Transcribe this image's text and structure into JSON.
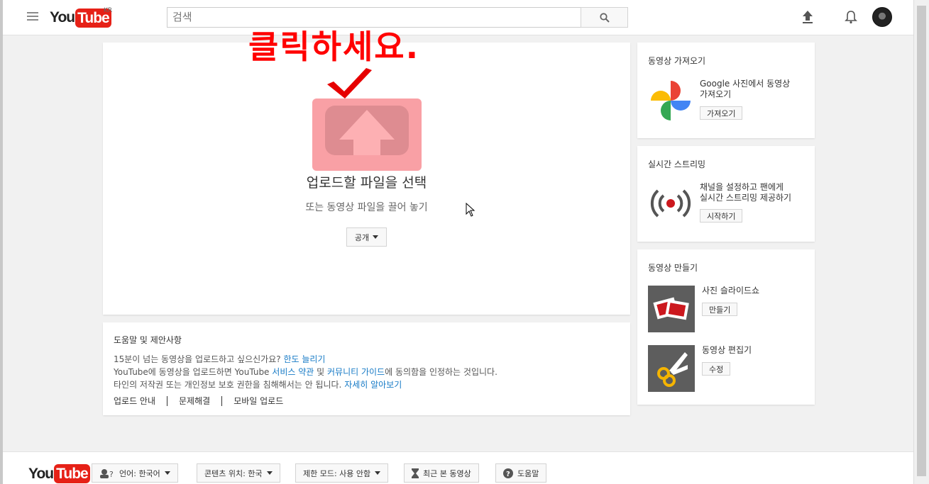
{
  "header": {
    "logo_you": "You",
    "logo_tube": "Tube",
    "region": "KR",
    "search_placeholder": "검색"
  },
  "upload": {
    "annotation": "클릭하세요.",
    "title": "업로드할 파일을 선택",
    "subtitle": "또는 동영상 파일을 끌어 놓기",
    "privacy_label": "공개"
  },
  "help": {
    "title": "도움말 및 제안사항",
    "line1": {
      "text": "15분이 넘는 동영상을 업로드하고 싶으신가요?",
      "link": "한도 늘리기"
    },
    "line2": {
      "p1": "YouTube에 동영상을 업로드하면 YouTube",
      "link1": "서비스 약관",
      "p2": "및",
      "link2": "커뮤니티 가이드",
      "p3": "에 동의함을 인정하는 것입니다."
    },
    "line3": {
      "text": "타인의 저작권 또는 개인정보 보호 권한을 침해해서는 안 됩니다.",
      "link": "자세히 알아보기"
    },
    "links": [
      "업로드 안내",
      "문제해결",
      "모바일 업로드"
    ]
  },
  "sidebar": {
    "import": {
      "title": "동영상 가져오기",
      "text1": "Google 사진에서 동영상",
      "text2": "가져오기",
      "button": "가져오기"
    },
    "live": {
      "title": "실시간 스트리밍",
      "text1": "채널을 설정하고 팬에게",
      "text2": "실시간 스트리밍 제공하기",
      "button": "시작하기"
    },
    "create": {
      "title": "동영상 만들기",
      "slideshow": "사진 슬라이드쇼",
      "slideshow_button": "만들기",
      "editor": "동영상 편집기",
      "editor_button": "수정"
    }
  },
  "footer": {
    "logo_you": "You",
    "logo_tube": "Tube",
    "language": "언어: 한국어",
    "location": "콘텐츠 위치: 한국",
    "restricted": "제한 모드: 사용 안함",
    "history": "최근 본 동영상",
    "help": "도움말"
  },
  "colors": {
    "brand_red": "#e62117",
    "link_blue": "#167ac6",
    "annotation_red": "#ff0000"
  }
}
